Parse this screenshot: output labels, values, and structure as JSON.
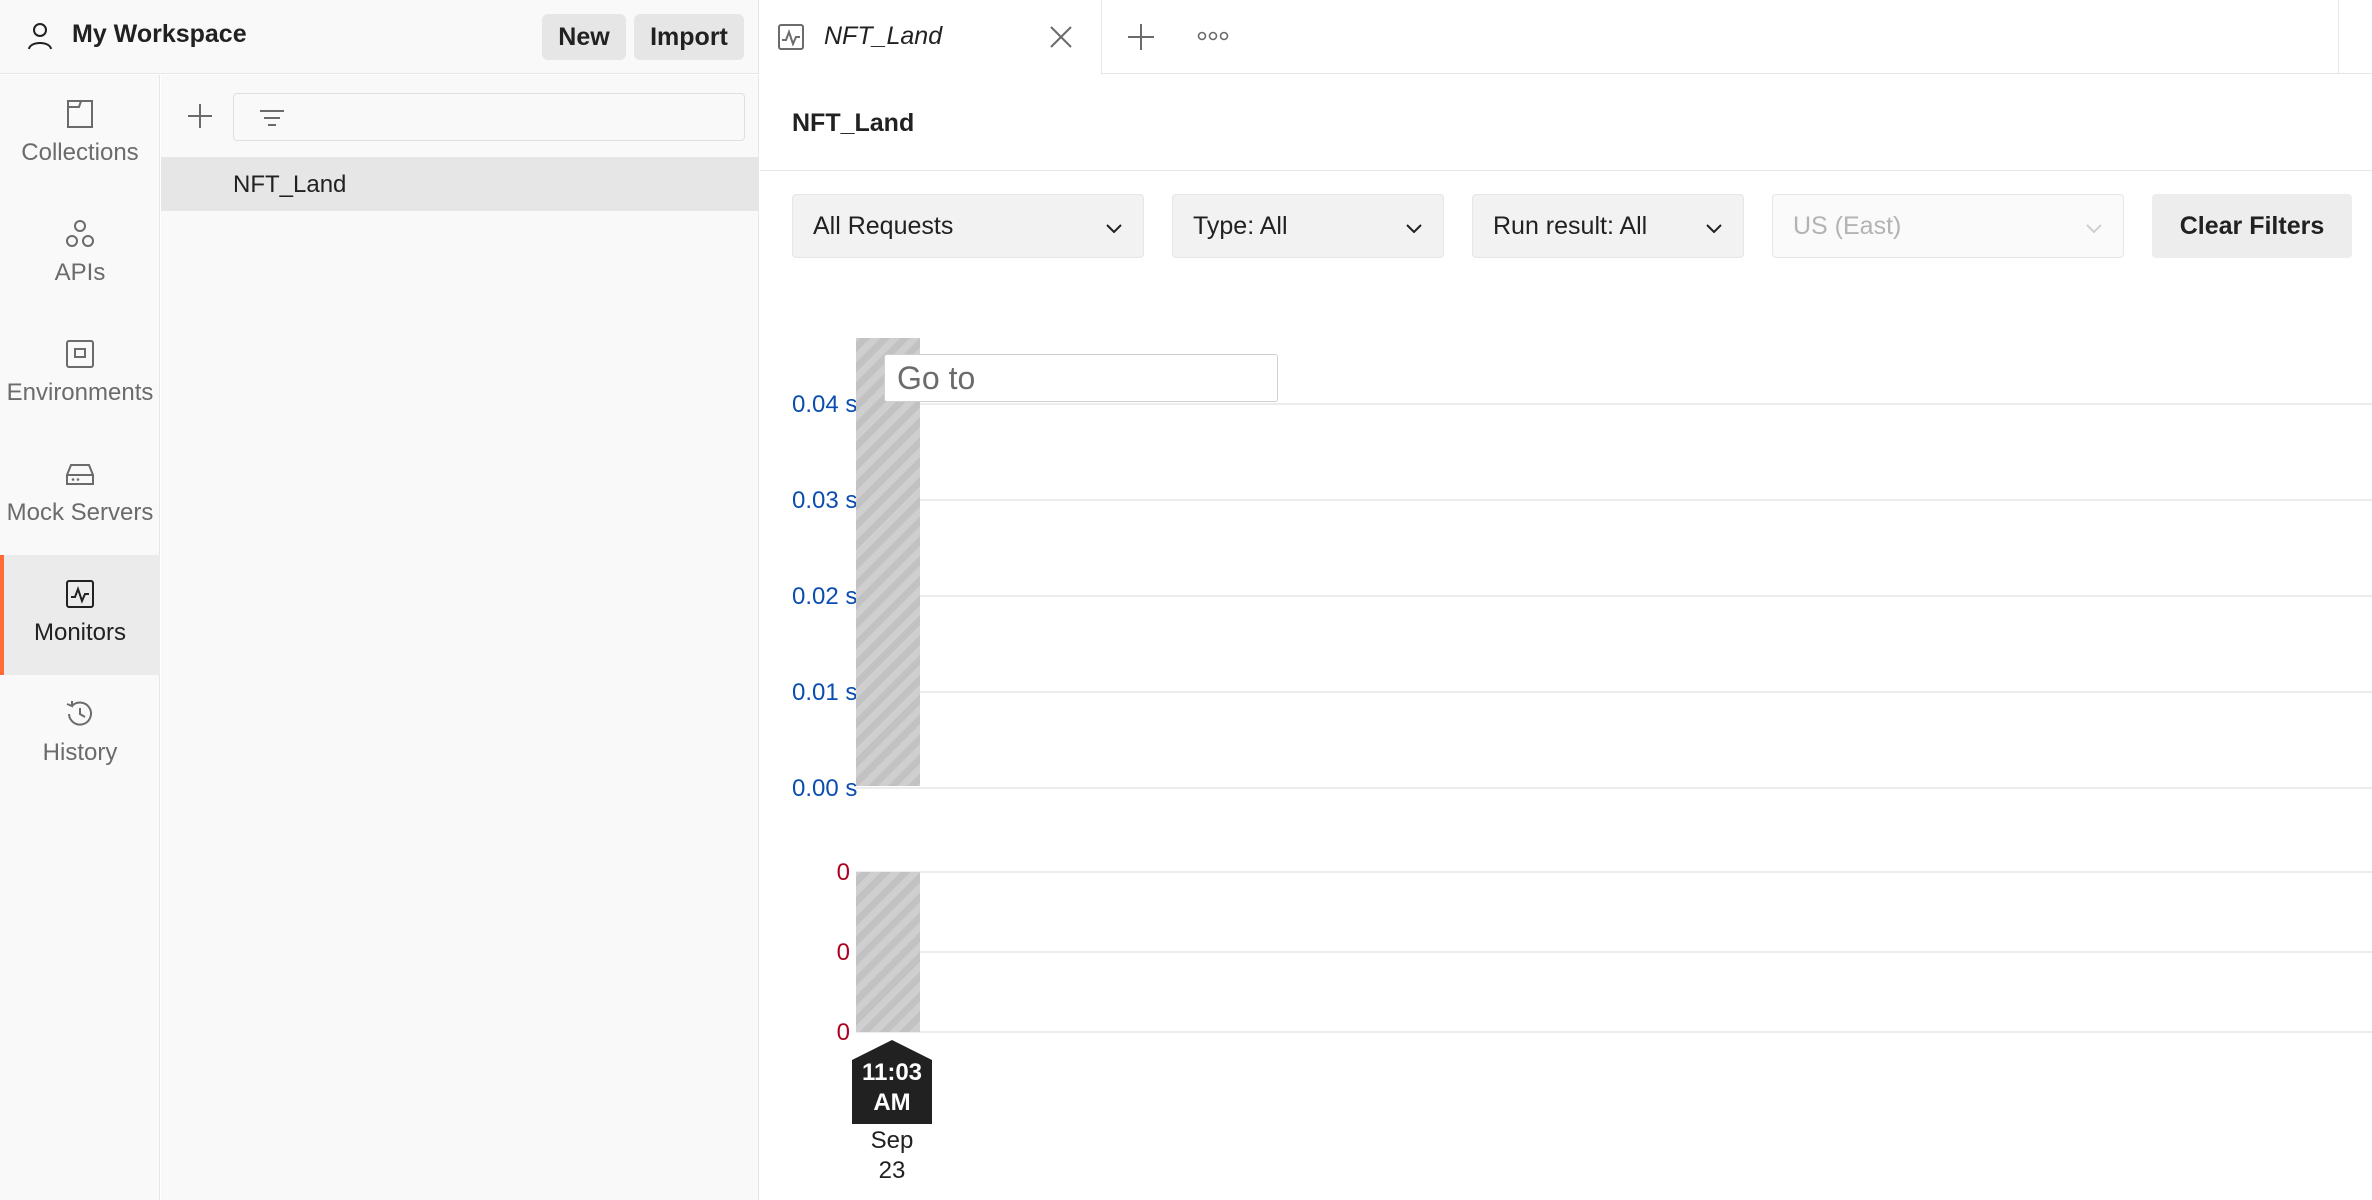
{
  "workspace": {
    "title": "My Workspace",
    "new_label": "New",
    "import_label": "Import"
  },
  "nav": {
    "items": [
      {
        "label": "Collections",
        "icon": "collections-icon"
      },
      {
        "label": "APIs",
        "icon": "apis-icon"
      },
      {
        "label": "Environments",
        "icon": "environments-icon"
      },
      {
        "label": "Mock Servers",
        "icon": "mock-servers-icon"
      },
      {
        "label": "Monitors",
        "icon": "monitors-icon",
        "active": true
      },
      {
        "label": "History",
        "icon": "history-icon"
      }
    ],
    "accent_color": "#ff6c37"
  },
  "sidebar": {
    "filter_placeholder": "",
    "items": [
      {
        "label": "NFT_Land",
        "selected": true
      }
    ]
  },
  "tabs": {
    "items": [
      {
        "label": "NFT_Land",
        "icon": "monitor-icon"
      }
    ]
  },
  "page": {
    "title": "NFT_Land"
  },
  "filters": {
    "requests": "All Requests",
    "type": "Type: All",
    "run_result": "Run result: All",
    "region": "US (East)",
    "clear_label": "Clear Filters"
  },
  "chart": {
    "goto_placeholder": "Go to",
    "time_label_line1": "11:03",
    "time_label_line2": "AM",
    "date_line1": "Sep",
    "date_line2": "23"
  },
  "chart_data": [
    {
      "type": "bar",
      "categories": [
        "11:03 AM Sep 23"
      ],
      "values": [
        0.045
      ],
      "ytick_labels": [
        "0.04 s",
        "0.03 s",
        "0.02 s",
        "0.01 s",
        "0.00 s"
      ],
      "ytick_values": [
        0.04,
        0.03,
        0.02,
        0.01,
        0.0
      ],
      "ylim": [
        0,
        0.045
      ],
      "tick_color": "#0b4eb0",
      "grid": true
    },
    {
      "type": "bar",
      "categories": [
        "11:03 AM Sep 23"
      ],
      "values": [
        1
      ],
      "ytick_labels": [
        "0",
        "0",
        "0"
      ],
      "ytick_values": [
        1,
        0.5,
        0
      ],
      "ylim": [
        0,
        1
      ],
      "tick_color": "#b00020",
      "grid": true
    }
  ]
}
